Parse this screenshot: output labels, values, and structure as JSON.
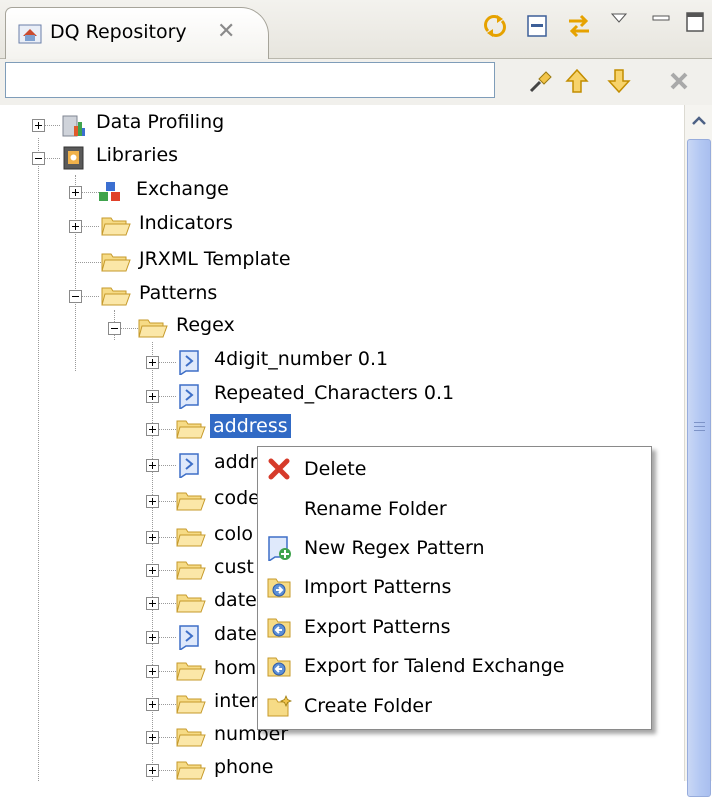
{
  "view": {
    "title": "DQ Repository",
    "close_glyph": "✕"
  },
  "toolbar": [
    "sync-icon",
    "collapse-all-icon",
    "link-editor-icon",
    "view-menu-icon",
    "minimize-icon",
    "maximize-icon"
  ],
  "filter": {
    "value": "",
    "placeholder": "",
    "buttons": [
      "pin-icon",
      "up-arrow-icon",
      "down-arrow-icon",
      "clear-icon"
    ]
  },
  "tree": [
    {
      "label": "Data Profiling",
      "icon": "data-profiling-icon"
    },
    {
      "label": "Libraries",
      "icon": "libraries-icon"
    },
    {
      "label": "Exchange",
      "icon": "exchange-icon"
    },
    {
      "label": "Indicators",
      "icon": "folder-icon"
    },
    {
      "label": "JRXML Template",
      "icon": "folder-icon"
    },
    {
      "label": "Patterns",
      "icon": "folder-icon"
    },
    {
      "label": "Regex",
      "icon": "folder-icon"
    },
    {
      "label": "4digit_number 0.1",
      "icon": "pattern-icon"
    },
    {
      "label": "Repeated_Characters 0.1",
      "icon": "pattern-icon"
    },
    {
      "label": "address",
      "icon": "folder-icon"
    },
    {
      "label": "addr",
      "icon": "pattern-icon"
    },
    {
      "label": "code",
      "icon": "folder-icon"
    },
    {
      "label": "colo",
      "icon": "folder-icon"
    },
    {
      "label": "cust",
      "icon": "folder-icon"
    },
    {
      "label": "date",
      "icon": "folder-icon"
    },
    {
      "label": "date",
      "icon": "pattern-icon"
    },
    {
      "label": "hom",
      "icon": "folder-icon"
    },
    {
      "label": "inter",
      "icon": "folder-icon"
    },
    {
      "label": "number",
      "icon": "folder-icon"
    },
    {
      "label": "phone",
      "icon": "folder-icon"
    }
  ],
  "context_menu": [
    {
      "label": "Delete",
      "icon": "delete-icon"
    },
    {
      "label": "Rename Folder",
      "icon": ""
    },
    {
      "label": "New Regex Pattern",
      "icon": "new-regex-pattern-icon"
    },
    {
      "label": "Import Patterns",
      "icon": "import-patterns-icon"
    },
    {
      "label": "Export Patterns",
      "icon": "export-patterns-icon"
    },
    {
      "label": "Export for Talend Exchange",
      "icon": "export-exchange-icon"
    },
    {
      "label": "Create Folder",
      "icon": "create-folder-icon"
    }
  ],
  "colors": {
    "selection": "#316ac5",
    "folder": "#f2c65a",
    "delete": "#d63a2a",
    "toolbar_accent": "#e6a200"
  }
}
